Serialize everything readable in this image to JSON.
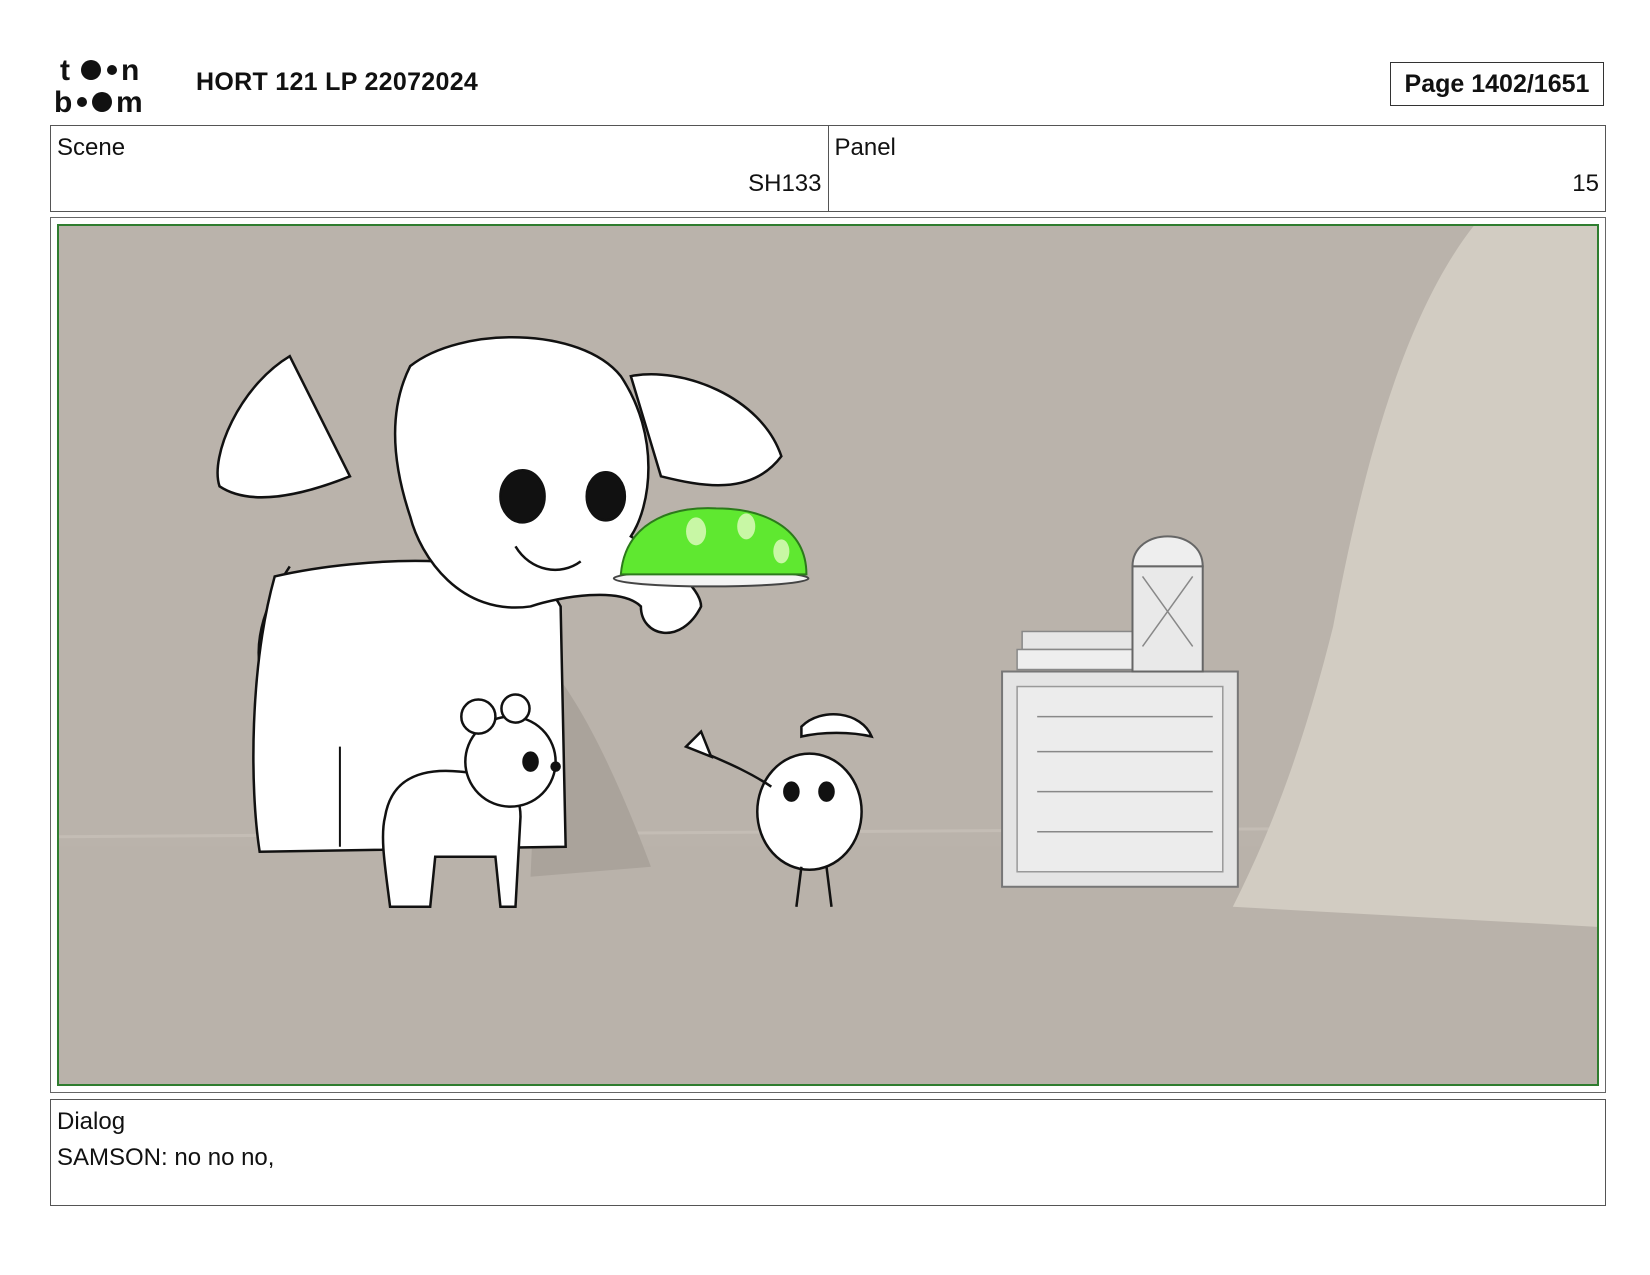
{
  "header": {
    "logo_text": "toon boom",
    "title": "HORT 121 LP 22072024",
    "page": "Page 1402/1651"
  },
  "info": {
    "scene_label": "Scene",
    "scene_value": "SH133",
    "panel_label": "Panel",
    "panel_value": "15"
  },
  "dialog": {
    "label": "Dialog",
    "text": "SAMSON: no no no,"
  },
  "colors": {
    "frame_border": "#2f7d2f",
    "background": "#bab3ab",
    "jelly": "#5fe830"
  }
}
